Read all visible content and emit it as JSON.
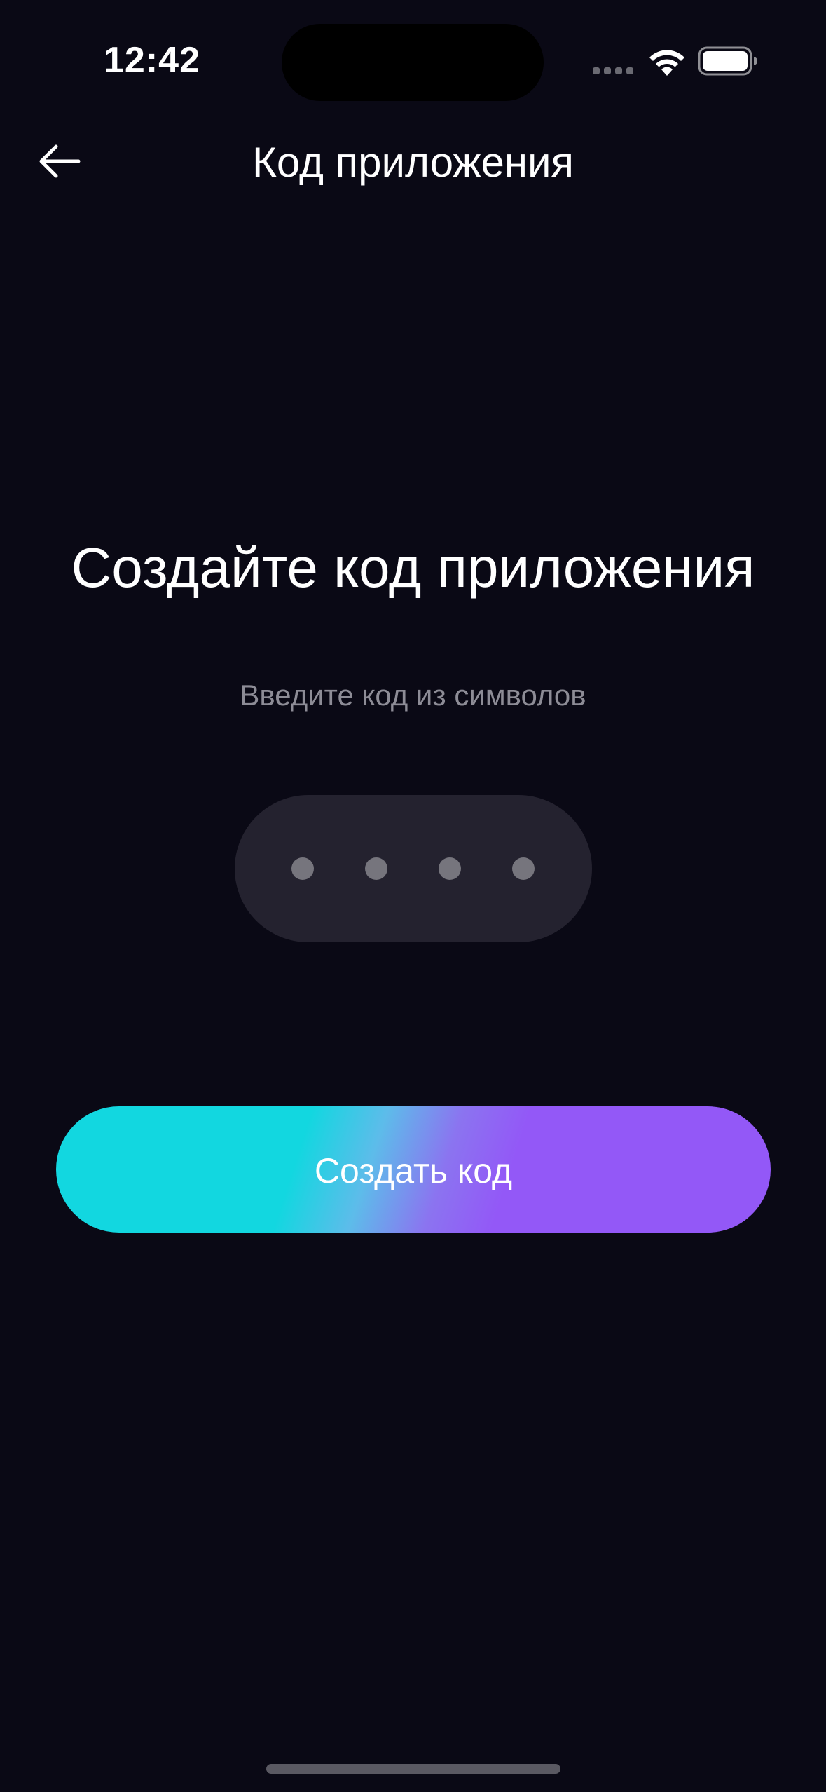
{
  "status_bar": {
    "time": "12:42",
    "icons": [
      "cellular-signal-icon",
      "wifi-icon",
      "battery-icon"
    ]
  },
  "header": {
    "title": "Код приложения",
    "back_icon": "arrow-left-icon"
  },
  "main": {
    "heading": "Создайте код приложения",
    "subtitle": "Введите код из символов",
    "code_input": {
      "length": 4,
      "entered": 0
    },
    "create_button_label": "Создать код"
  },
  "colors": {
    "background": "#0a0915",
    "input_background": "#24222f",
    "gradient_start": "#12d7e0",
    "gradient_end": "#9358f7",
    "subtitle_text": "#8d8c96"
  }
}
